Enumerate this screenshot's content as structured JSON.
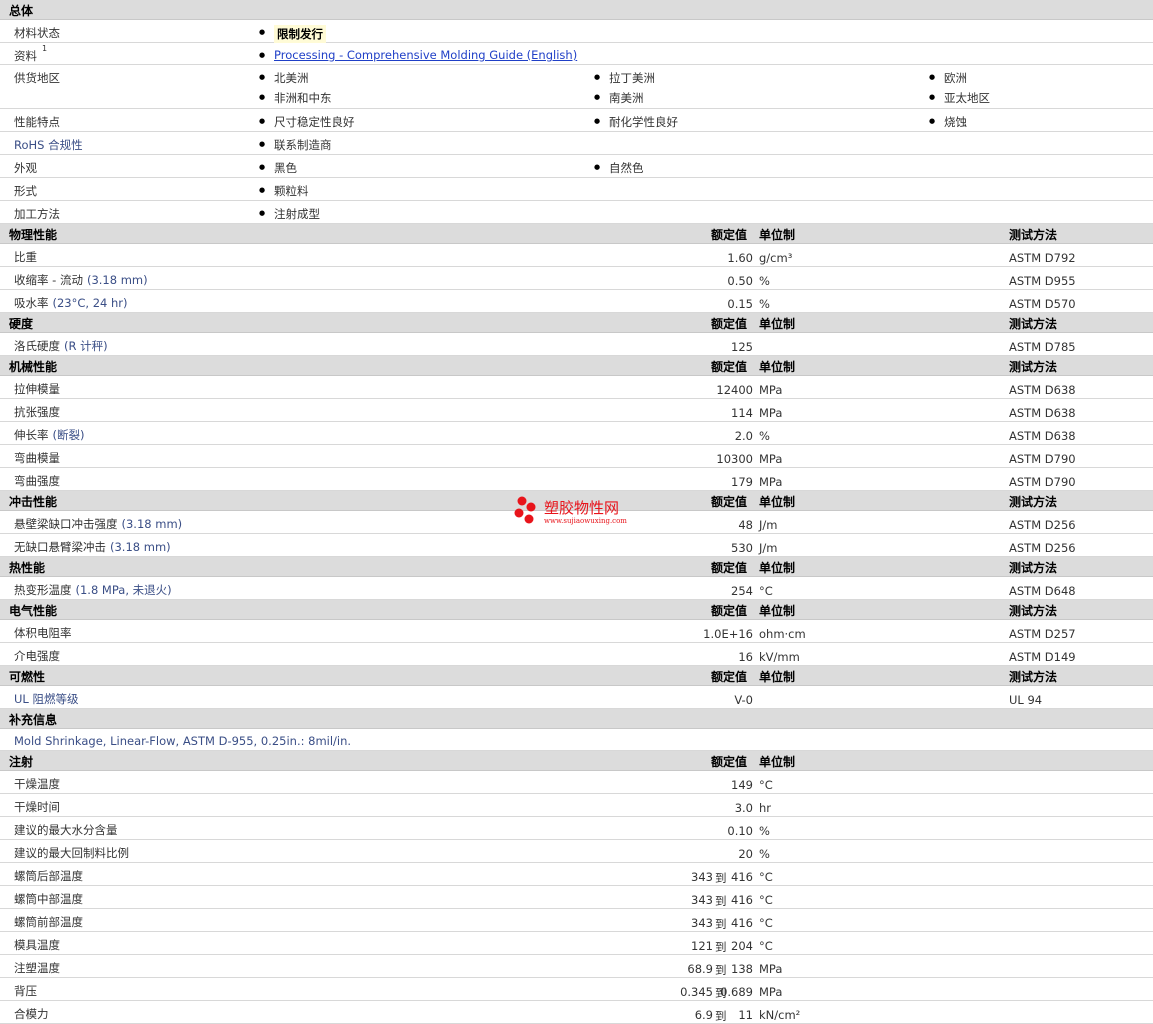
{
  "general": {
    "title": "总体",
    "rows": [
      {
        "label": "材料状态",
        "values": [
          "限制发行"
        ]
      },
      {
        "label": "资料",
        "sup": "1",
        "values": [
          "Processing - Comprehensive Molding Guide (English)"
        ]
      },
      {
        "label": "供货地区",
        "values": [
          "北美洲",
          "拉丁美洲",
          "欧洲",
          "非洲和中东",
          "南美洲",
          "亚太地区"
        ]
      },
      {
        "label": "性能特点",
        "values": [
          "尺寸稳定性良好",
          "耐化学性良好",
          "烧蚀"
        ]
      },
      {
        "label": "RoHS 合规性",
        "values": [
          "联系制造商"
        ]
      },
      {
        "label": "外观",
        "values": [
          "黑色",
          "自然色"
        ]
      },
      {
        "label": "形式",
        "values": [
          "颗粒料"
        ]
      },
      {
        "label": "加工方法",
        "values": [
          "注射成型"
        ]
      }
    ]
  },
  "col_headers": {
    "nominal": "额定值",
    "unit": "单位制",
    "method": "测试方法"
  },
  "sections": [
    {
      "title": "物理性能",
      "rows": [
        {
          "label": "比重",
          "value": "1.60",
          "unit": "g/cm³",
          "method": "ASTM D792"
        },
        {
          "label": "收缩率 - 流动",
          "cond": "(3.18 mm)",
          "value": "0.50",
          "unit": "%",
          "method": "ASTM D955"
        },
        {
          "label": "吸水率",
          "cond": "(23°C, 24 hr)",
          "value": "0.15",
          "unit": "%",
          "method": "ASTM D570"
        }
      ]
    },
    {
      "title": "硬度",
      "rows": [
        {
          "label": "洛氏硬度",
          "cond": "(R 计秤)",
          "value": "125",
          "unit": "",
          "method": "ASTM D785"
        }
      ]
    },
    {
      "title": "机械性能",
      "rows": [
        {
          "label": "拉伸模量",
          "value": "12400",
          "unit": "MPa",
          "method": "ASTM D638"
        },
        {
          "label": "抗张强度",
          "value": "114",
          "unit": "MPa",
          "method": "ASTM D638"
        },
        {
          "label": "伸长率",
          "cond": "(断裂)",
          "value": "2.0",
          "unit": "%",
          "method": "ASTM D638"
        },
        {
          "label": "弯曲模量",
          "value": "10300",
          "unit": "MPa",
          "method": "ASTM D790"
        },
        {
          "label": "弯曲强度",
          "value": "179",
          "unit": "MPa",
          "method": "ASTM D790"
        }
      ]
    },
    {
      "title": "冲击性能",
      "rows": [
        {
          "label": "悬壁梁缺口冲击强度",
          "cond": "(3.18 mm)",
          "value": "48",
          "unit": "J/m",
          "method": "ASTM D256"
        },
        {
          "label": "无缺口悬臂梁冲击",
          "cond": "(3.18 mm)",
          "value": "530",
          "unit": "J/m",
          "method": "ASTM D256"
        }
      ]
    },
    {
      "title": "热性能",
      "rows": [
        {
          "label": "热变形温度",
          "cond": "(1.8 MPa, 未退火)",
          "value": "254",
          "unit": "°C",
          "method": "ASTM D648"
        }
      ]
    },
    {
      "title": "电气性能",
      "rows": [
        {
          "label": "体积电阻率",
          "value": "1.0E+16",
          "unit": "ohm·cm",
          "method": "ASTM D257"
        },
        {
          "label": "介电强度",
          "value": "16",
          "unit": "kV/mm",
          "method": "ASTM D149"
        }
      ]
    },
    {
      "title": "可燃性",
      "rows": [
        {
          "label": "UL 阻燃等级",
          "value": "V-0",
          "unit": "",
          "method": "UL 94"
        }
      ]
    }
  ],
  "supplement": {
    "title": "补充信息",
    "text": "Mold Shrinkage, Linear-Flow, ASTM D-955, 0.25in.: 8mil/in."
  },
  "injection": {
    "title": "注射",
    "to_word": "到",
    "rows": [
      {
        "label": "干燥温度",
        "value": "149",
        "unit": "°C"
      },
      {
        "label": "干燥时间",
        "value": "3.0",
        "unit": "hr"
      },
      {
        "label": "建议的最大水分含量",
        "value": "0.10",
        "unit": "%"
      },
      {
        "label": "建议的最大回制料比例",
        "value": "20",
        "unit": "%"
      },
      {
        "label": "螺筒后部温度",
        "from": "343",
        "value": "416",
        "unit": "°C"
      },
      {
        "label": "螺筒中部温度",
        "from": "343",
        "value": "416",
        "unit": "°C"
      },
      {
        "label": "螺筒前部温度",
        "from": "343",
        "value": "416",
        "unit": "°C"
      },
      {
        "label": "模具温度",
        "from": "121",
        "value": "204",
        "unit": "°C"
      },
      {
        "label": "注塑温度",
        "from": "68.9",
        "value": "138",
        "unit": "MPa"
      },
      {
        "label": "背压",
        "from": "0.345",
        "value": "0.689",
        "unit": "MPa"
      },
      {
        "label": "合模力",
        "from": "6.9",
        "value": "11",
        "unit": "kN/cm²"
      }
    ]
  },
  "watermark": {
    "text": "塑胶物性网",
    "url": "www.sujiaowuxing.com",
    "color": "#e8141b"
  }
}
